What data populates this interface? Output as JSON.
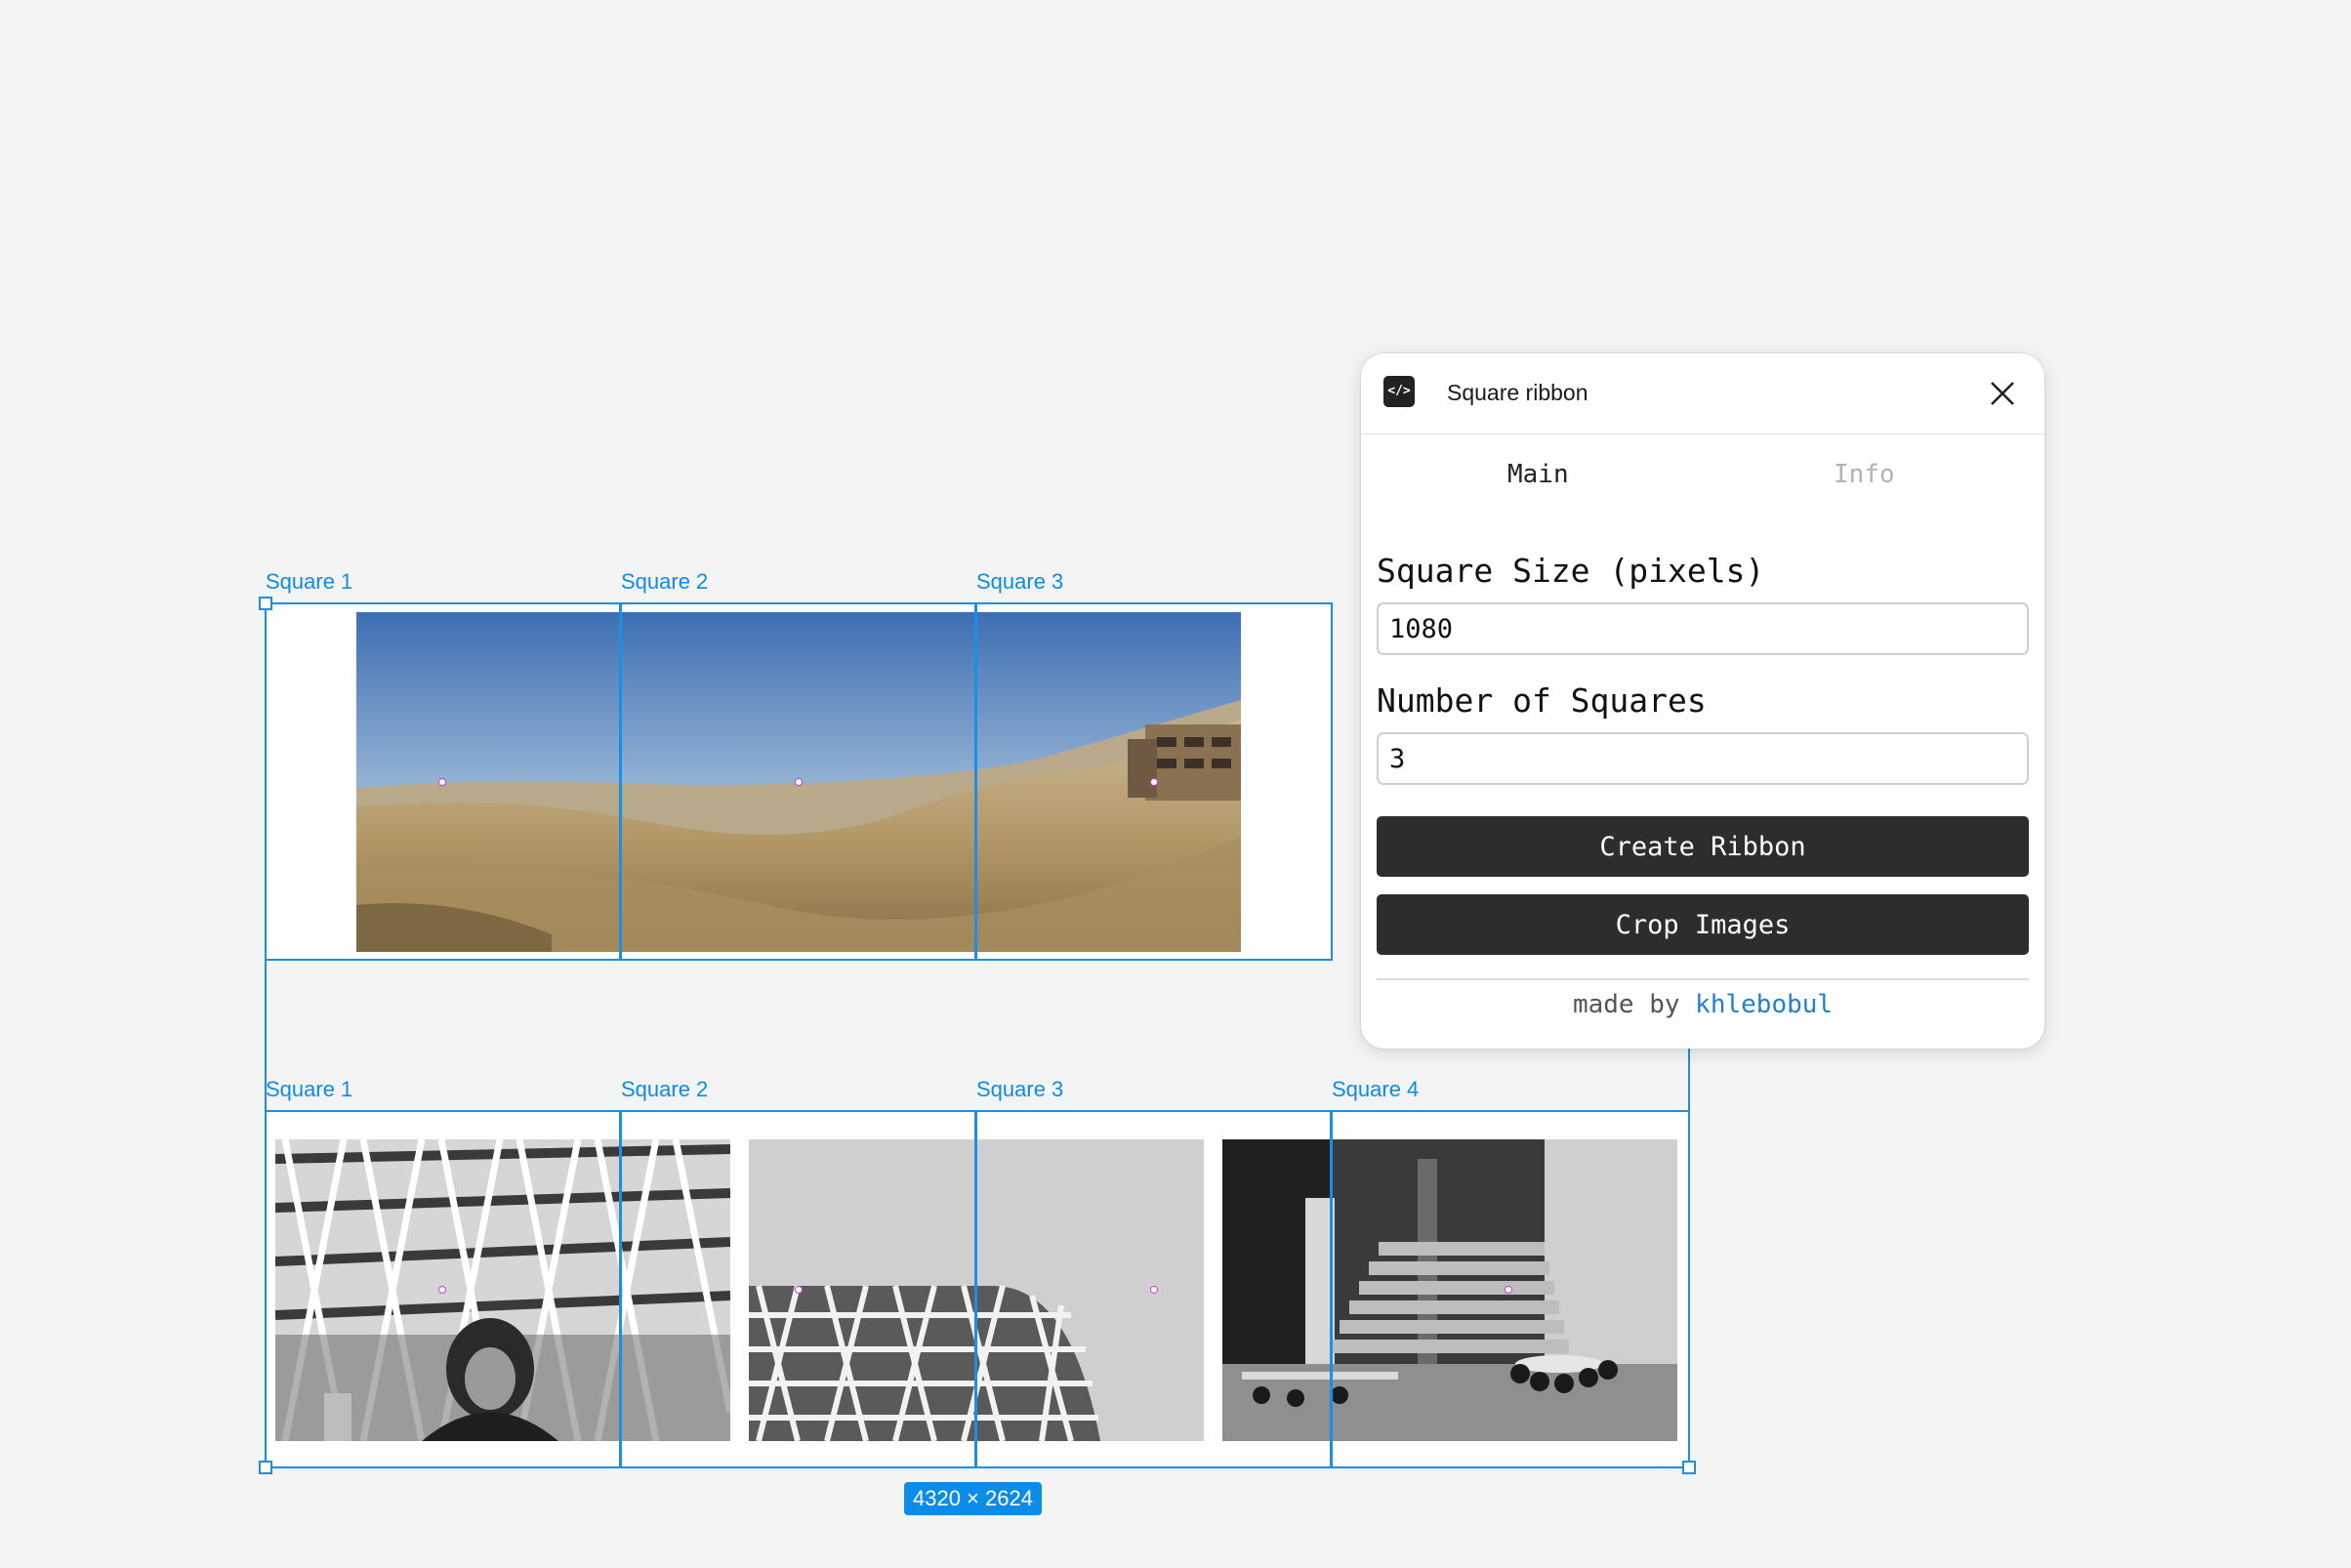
{
  "canvas": {
    "top_ribbon": {
      "square_labels": [
        "Square 1",
        "Square 2",
        "Square 3"
      ]
    },
    "bottom_ribbon": {
      "square_labels": [
        "Square 1",
        "Square 2",
        "Square 3",
        "Square 4"
      ]
    },
    "selection_size": "4320 × 2624"
  },
  "plugin": {
    "title": "Square ribbon",
    "icon": "code-icon",
    "tabs": [
      {
        "label": "Main",
        "active": true
      },
      {
        "label": "Info",
        "active": false
      }
    ],
    "square_size": {
      "label": "Square Size (pixels)",
      "value": "1080"
    },
    "number_of_squares": {
      "label": "Number of Squares",
      "value": "3"
    },
    "create_ribbon_label": "Create Ribbon",
    "crop_images_label": "Crop Images",
    "footer": {
      "prefix": "made by",
      "author": "khlebobul"
    }
  },
  "colors": {
    "canvas_bg": "#f4f4f4",
    "selection": "#1a8fe8",
    "button_bg": "#2d2d2d",
    "link": "#1f7fd6"
  }
}
